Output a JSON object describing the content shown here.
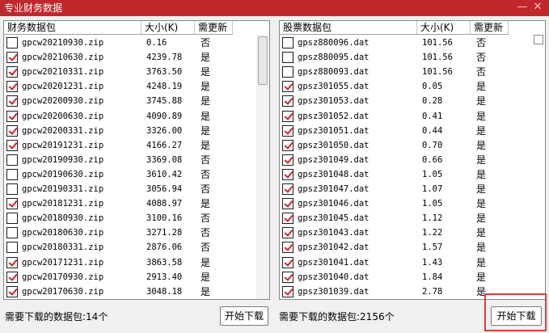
{
  "window": {
    "title": "专业财务数据",
    "minimize_glyph": "—",
    "close_glyph": "✕"
  },
  "left_panel": {
    "headers": {
      "name": "财务数据包",
      "size": "大小(K)",
      "update": "需更新"
    },
    "rows": [
      {
        "checked": false,
        "name": "gpcw20210930.zip",
        "size": "0.16",
        "update": "否"
      },
      {
        "checked": true,
        "name": "gpcw20210630.zip",
        "size": "4239.78",
        "update": "是"
      },
      {
        "checked": true,
        "name": "gpcw20210331.zip",
        "size": "3763.50",
        "update": "是"
      },
      {
        "checked": true,
        "name": "gpcw20201231.zip",
        "size": "4248.19",
        "update": "是"
      },
      {
        "checked": true,
        "name": "gpcw20200930.zip",
        "size": "3745.88",
        "update": "是"
      },
      {
        "checked": true,
        "name": "gpcw20200630.zip",
        "size": "4090.89",
        "update": "是"
      },
      {
        "checked": true,
        "name": "gpcw20200331.zip",
        "size": "3326.00",
        "update": "是"
      },
      {
        "checked": true,
        "name": "gpcw20191231.zip",
        "size": "4166.27",
        "update": "是"
      },
      {
        "checked": false,
        "name": "gpcw20190930.zip",
        "size": "3369.08",
        "update": "否"
      },
      {
        "checked": false,
        "name": "gpcw20190630.zip",
        "size": "3610.42",
        "update": "否"
      },
      {
        "checked": false,
        "name": "gpcw20190331.zip",
        "size": "3056.94",
        "update": "否"
      },
      {
        "checked": true,
        "name": "gpcw20181231.zip",
        "size": "4088.97",
        "update": "是"
      },
      {
        "checked": false,
        "name": "gpcw20180930.zip",
        "size": "3100.16",
        "update": "否"
      },
      {
        "checked": false,
        "name": "gpcw20180630.zip",
        "size": "3271.28",
        "update": "否"
      },
      {
        "checked": false,
        "name": "gpcw20180331.zip",
        "size": "2876.06",
        "update": "否"
      },
      {
        "checked": true,
        "name": "gpcw20171231.zip",
        "size": "3863.58",
        "update": "是"
      },
      {
        "checked": true,
        "name": "gpcw20170930.zip",
        "size": "2913.40",
        "update": "是"
      },
      {
        "checked": true,
        "name": "gpcw20170630.zip",
        "size": "3048.18",
        "update": "是"
      }
    ],
    "status_text": "需要下载的数据包:14个",
    "button_label": "开始下载"
  },
  "right_panel": {
    "headers": {
      "name": "股票数据包",
      "size": "大小(K)",
      "update": "需更新"
    },
    "rows": [
      {
        "checked": false,
        "name": "gpsz880096.dat",
        "size": "101.56",
        "update": "否"
      },
      {
        "checked": false,
        "name": "gpsz880095.dat",
        "size": "101.56",
        "update": "否"
      },
      {
        "checked": false,
        "name": "gpsz880093.dat",
        "size": "101.56",
        "update": "否"
      },
      {
        "checked": true,
        "name": "gpsz301055.dat",
        "size": "0.05",
        "update": "是"
      },
      {
        "checked": true,
        "name": "gpsz301053.dat",
        "size": "0.28",
        "update": "是"
      },
      {
        "checked": true,
        "name": "gpsz301052.dat",
        "size": "0.41",
        "update": "是"
      },
      {
        "checked": true,
        "name": "gpsz301051.dat",
        "size": "0.44",
        "update": "是"
      },
      {
        "checked": true,
        "name": "gpsz301050.dat",
        "size": "0.70",
        "update": "是"
      },
      {
        "checked": true,
        "name": "gpsz301049.dat",
        "size": "0.66",
        "update": "是"
      },
      {
        "checked": true,
        "name": "gpsz301048.dat",
        "size": "1.05",
        "update": "是"
      },
      {
        "checked": true,
        "name": "gpsz301047.dat",
        "size": "1.07",
        "update": "是"
      },
      {
        "checked": true,
        "name": "gpsz301046.dat",
        "size": "1.05",
        "update": "是"
      },
      {
        "checked": true,
        "name": "gpsz301045.dat",
        "size": "1.12",
        "update": "是"
      },
      {
        "checked": true,
        "name": "gpsz301043.dat",
        "size": "1.22",
        "update": "是"
      },
      {
        "checked": true,
        "name": "gpsz301042.dat",
        "size": "1.57",
        "update": "是"
      },
      {
        "checked": true,
        "name": "gpsz301041.dat",
        "size": "1.43",
        "update": "是"
      },
      {
        "checked": true,
        "name": "gpsz301040.dat",
        "size": "1.84",
        "update": "是"
      },
      {
        "checked": true,
        "name": "gpsz301039.dat",
        "size": "2.78",
        "update": "是"
      }
    ],
    "status_text": "需要下载的数据包:2156个",
    "button_label": "开始下载"
  }
}
